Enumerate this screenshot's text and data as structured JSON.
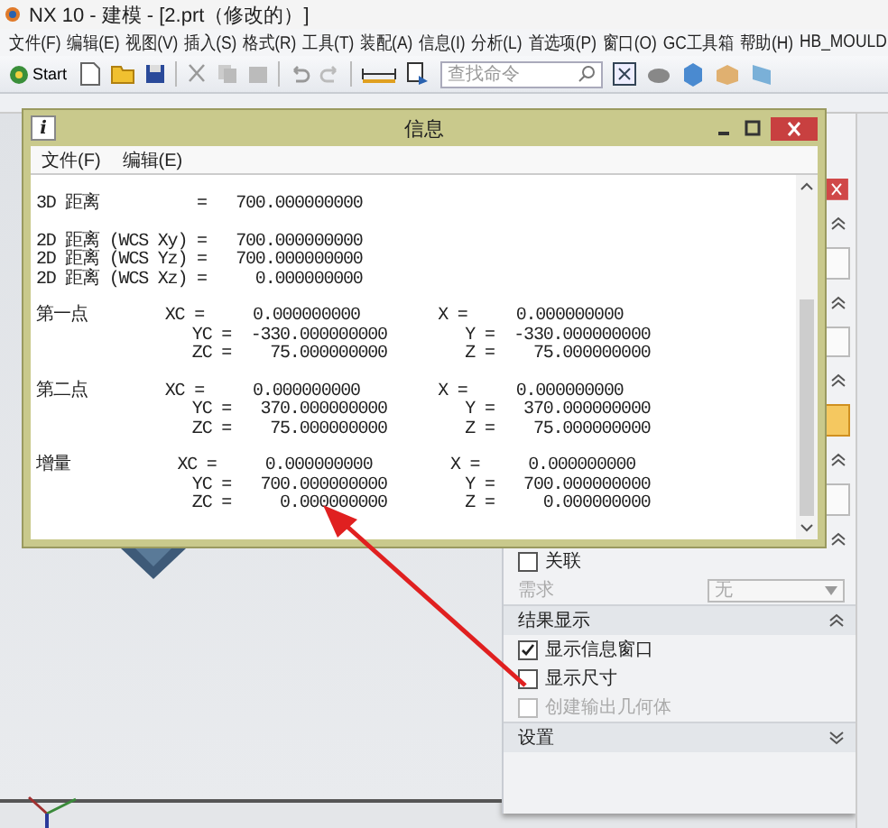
{
  "window": {
    "title": "NX 10 - 建模 - [2.prt（修改的）]"
  },
  "menu": [
    "文件(F)",
    "编辑(E)",
    "视图(V)",
    "插入(S)",
    "格式(R)",
    "工具(T)",
    "装配(A)",
    "信息(I)",
    "分析(L)",
    "首选项(P)",
    "窗口(O)",
    "GC工具箱",
    "帮助(H)",
    "HB_MOULD"
  ],
  "toolbar": {
    "start": "Start",
    "search_placeholder": "查找命令"
  },
  "info_window": {
    "icon": "i",
    "title": "信息",
    "menu": [
      "文件(F)",
      "编辑(E)"
    ],
    "blocks": [
      [
        "3D 距离          =   700.000000000"
      ],
      [
        "2D 距离 (WCS Xy) =   700.000000000",
        "2D 距离 (WCS Yz) =   700.000000000",
        "2D 距离 (WCS Xz) =     0.000000000"
      ],
      [
        "第一点        XC =     0.000000000        X =     0.000000000",
        "                YC =  -330.000000000        Y =  -330.000000000",
        "                ZC =    75.000000000        Z =    75.000000000"
      ],
      [
        "第二点        XC =     0.000000000        X =     0.000000000",
        "                YC =   370.000000000        Y =   370.000000000",
        "                ZC =    75.000000000        Z =    75.000000000"
      ],
      [
        "增量           XC =     0.000000000        X =     0.000000000",
        "                YC =   700.000000000        Y =   700.000000000",
        "                ZC =     0.000000000        Z =     0.000000000"
      ]
    ]
  },
  "panel": {
    "rows": [
      {
        "kind": "checkbox",
        "label": "关联",
        "checked": false,
        "disabled": false
      },
      {
        "kind": "select",
        "label": "需求",
        "value": "无",
        "disabled": true
      },
      {
        "kind": "section",
        "label": "结果显示",
        "expanded": true
      },
      {
        "kind": "checkbox",
        "label": "显示信息窗口",
        "checked": true,
        "disabled": false
      },
      {
        "kind": "checkbox",
        "label": "显示尺寸",
        "checked": false,
        "disabled": false
      },
      {
        "kind": "checkbox",
        "label": "创建输出几何体",
        "checked": false,
        "disabled": true
      },
      {
        "kind": "section",
        "label": "设置",
        "expanded": false
      }
    ]
  }
}
